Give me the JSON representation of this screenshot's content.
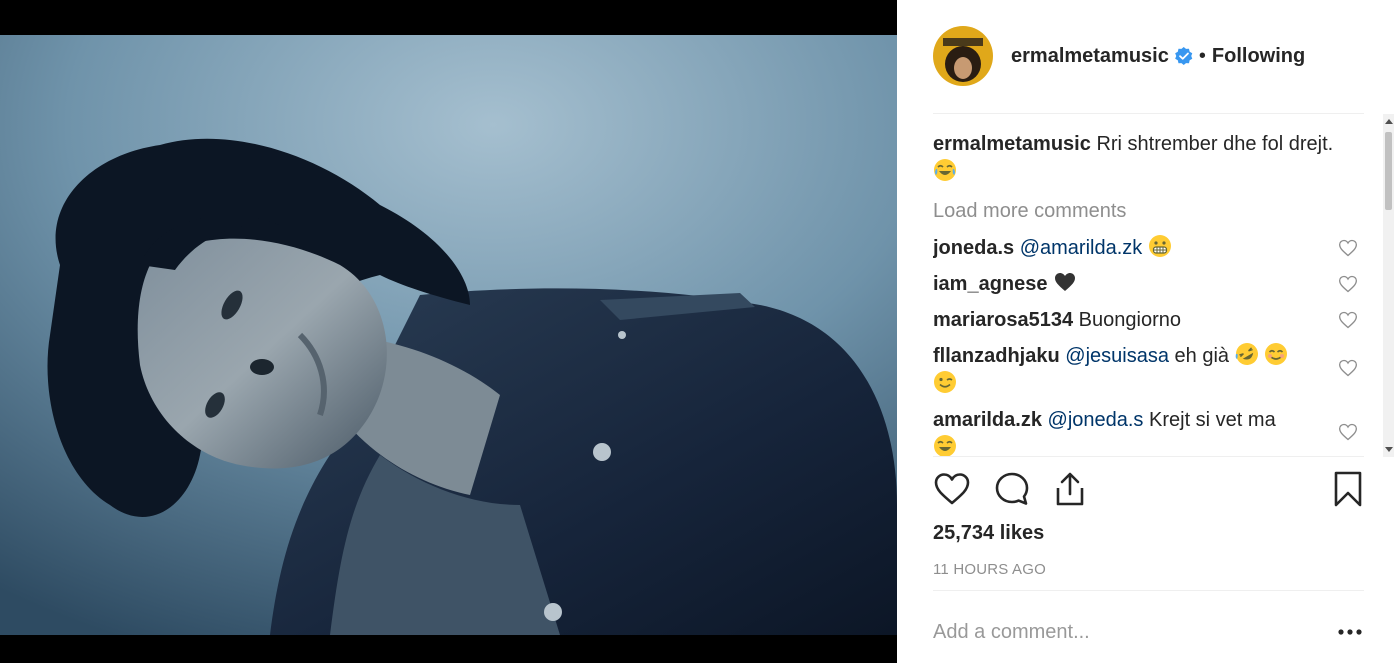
{
  "post": {
    "username": "ermalmetamusic",
    "separator": "•",
    "follow_status": "Following",
    "caption_text": "Rri shtrember dhe fol drejt."
  },
  "comments": {
    "load_more": "Load more comments",
    "items": [
      {
        "user": "joneda.s",
        "mention": "@amarilda.zk",
        "text": ""
      },
      {
        "user": "iam_agnese",
        "mention": "",
        "text": ""
      },
      {
        "user": "mariarosa5134",
        "mention": "",
        "text": "Buongiorno"
      },
      {
        "user": "fllanzadhjaku",
        "mention": "@jesuisasa",
        "text": "eh già"
      },
      {
        "user": "amarilda.zk",
        "mention": "@joneda.s",
        "text": "Krejt si vet ma"
      }
    ]
  },
  "stats": {
    "likes": "25,734 likes",
    "time": "11 HOURS AGO"
  },
  "composer": {
    "placeholder": "Add a comment..."
  },
  "icons": {
    "verified": "verified-badge-icon",
    "heart": "heart-outline-icon",
    "comment": "comment-bubble-icon",
    "share": "share-upload-icon",
    "bookmark": "bookmark-icon",
    "more": "more-options-icon"
  },
  "colors": {
    "verified_blue": "#3897f0",
    "text": "#262626",
    "muted": "#8e8e8e",
    "mention": "#003569",
    "divider": "#efefef"
  }
}
